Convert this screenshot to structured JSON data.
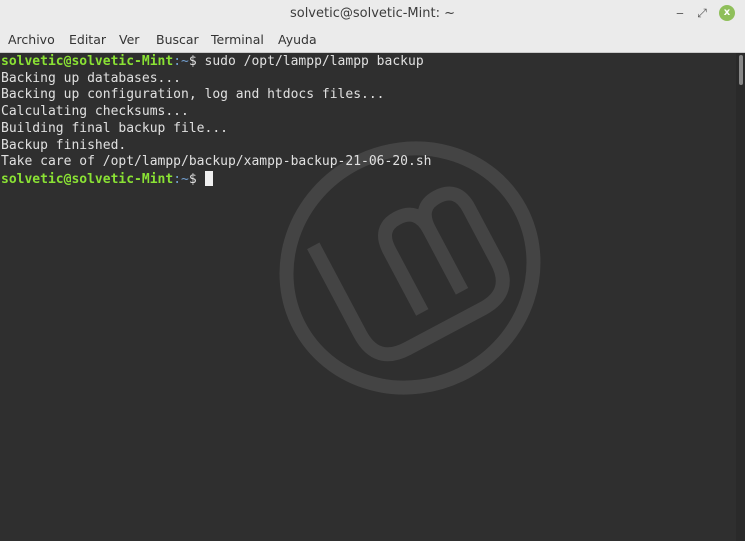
{
  "window": {
    "title": "solvetic@solvetic-Mint: ~",
    "minimize": "‒",
    "maximize": "⤢",
    "close": "x"
  },
  "menu": [
    "Archivo",
    "Editar",
    "Ver",
    "Buscar",
    "Terminal",
    "Ayuda"
  ],
  "terminal": {
    "prompt_user": "solvetic@solvetic-Mint",
    "prompt_path": ":~",
    "prompt_symbol": "$ ",
    "command": "sudo /opt/lampp/lampp backup",
    "output": [
      "Backing up databases...",
      "Backing up configuration, log and htdocs files...",
      "Calculating checksums...",
      "Building final backup file...",
      "Backup finished.",
      "Take care of /opt/lampp/backup/xampp-backup-21-06-20.sh"
    ]
  }
}
